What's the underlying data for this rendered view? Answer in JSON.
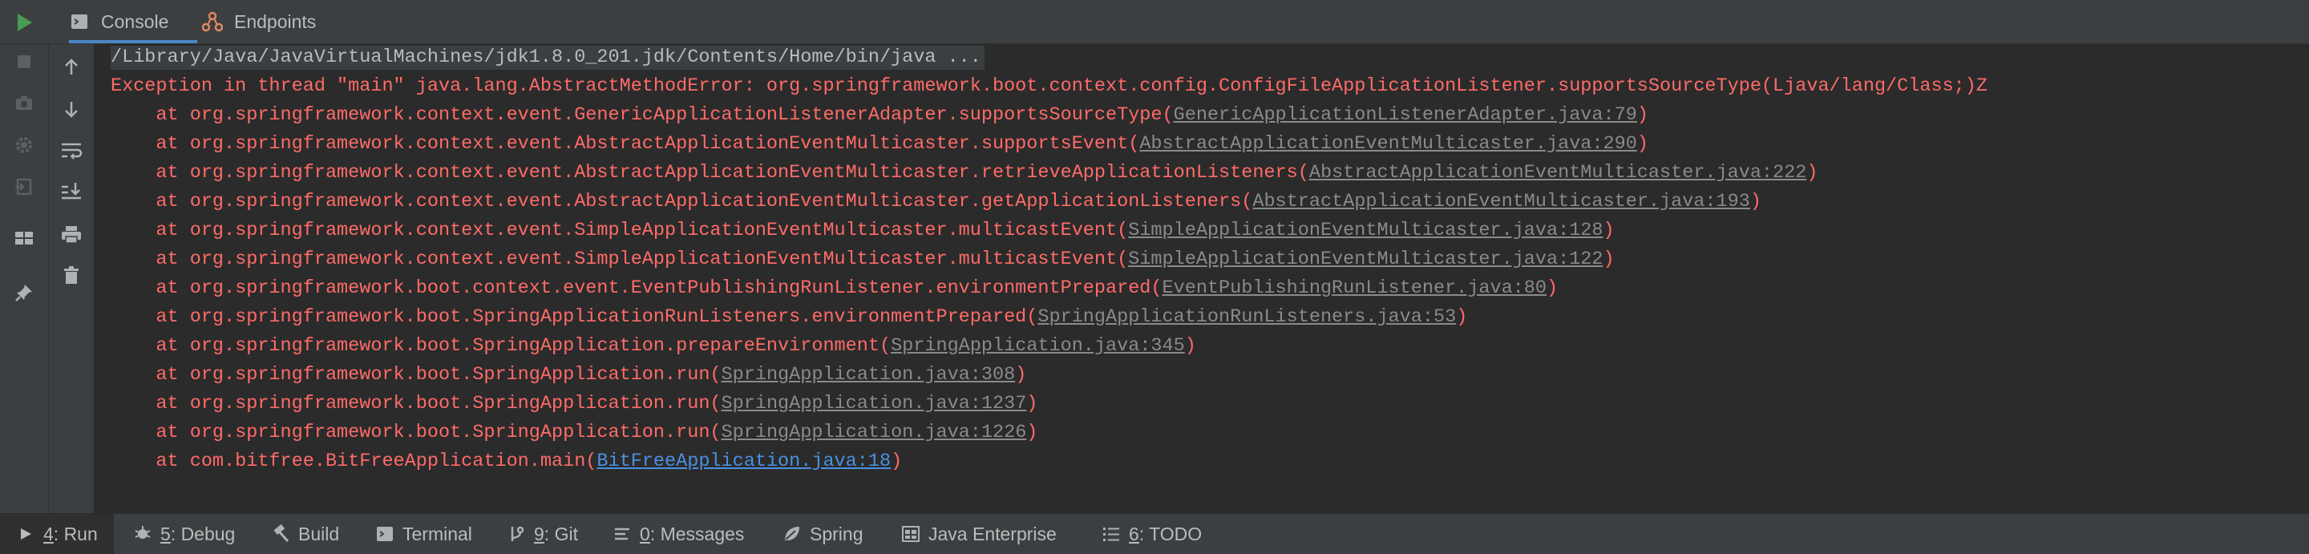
{
  "top_tabs": {
    "console": "Console",
    "endpoints": "Endpoints"
  },
  "console": {
    "command": "/Library/Java/JavaVirtualMachines/jdk1.8.0_201.jdk/Contents/Home/bin/java ...",
    "exception": "Exception in thread \"main\" java.lang.AbstractMethodError: org.springframework.boot.context.config.ConfigFileApplicationListener.supportsSourceType(Ljava/lang/Class;)Z",
    "frames": [
      {
        "text": "    at org.springframework.context.event.GenericApplicationListenerAdapter.supportsSourceType(",
        "link": "GenericApplicationListenerAdapter.java:79",
        "tail": ")"
      },
      {
        "text": "    at org.springframework.context.event.AbstractApplicationEventMulticaster.supportsEvent(",
        "link": "AbstractApplicationEventMulticaster.java:290",
        "tail": ")"
      },
      {
        "text": "    at org.springframework.context.event.AbstractApplicationEventMulticaster.retrieveApplicationListeners(",
        "link": "AbstractApplicationEventMulticaster.java:222",
        "tail": ")"
      },
      {
        "text": "    at org.springframework.context.event.AbstractApplicationEventMulticaster.getApplicationListeners(",
        "link": "AbstractApplicationEventMulticaster.java:193",
        "tail": ")"
      },
      {
        "text": "    at org.springframework.context.event.SimpleApplicationEventMulticaster.multicastEvent(",
        "link": "SimpleApplicationEventMulticaster.java:128",
        "tail": ")"
      },
      {
        "text": "    at org.springframework.context.event.SimpleApplicationEventMulticaster.multicastEvent(",
        "link": "SimpleApplicationEventMulticaster.java:122",
        "tail": ")"
      },
      {
        "text": "    at org.springframework.boot.context.event.EventPublishingRunListener.environmentPrepared(",
        "link": "EventPublishingRunListener.java:80",
        "tail": ")"
      },
      {
        "text": "    at org.springframework.boot.SpringApplicationRunListeners.environmentPrepared(",
        "link": "SpringApplicationRunListeners.java:53",
        "tail": ")"
      },
      {
        "text": "    at org.springframework.boot.SpringApplication.prepareEnvironment(",
        "link": "SpringApplication.java:345",
        "tail": ")"
      },
      {
        "text": "    at org.springframework.boot.SpringApplication.run(",
        "link": "SpringApplication.java:308",
        "tail": ")"
      },
      {
        "text": "    at org.springframework.boot.SpringApplication.run(",
        "link": "SpringApplication.java:1237",
        "tail": ")"
      },
      {
        "text": "    at org.springframework.boot.SpringApplication.run(",
        "link": "SpringApplication.java:1226",
        "tail": ")"
      },
      {
        "text": "    at com.bitfree.BitFreeApplication.main(",
        "link": "BitFreeApplication.java:18",
        "tail": ")"
      }
    ]
  },
  "bottom": {
    "run": {
      "key": "4",
      "label": ": Run"
    },
    "debug": {
      "key": "5",
      "label": ": Debug"
    },
    "build": "Build",
    "terminal": "Terminal",
    "git": {
      "key": "9",
      "label": ": Git"
    },
    "messages": {
      "key": "0",
      "label": ": Messages"
    },
    "spring": "Spring",
    "java_enterprise": "Java Enterprise",
    "todo": {
      "key": "6",
      "label": ": TODO"
    }
  },
  "colors": {
    "error": "#ff6b68",
    "link": "#8a8a8a",
    "user_link": "#4a90e2",
    "run_green": "#499c54"
  }
}
